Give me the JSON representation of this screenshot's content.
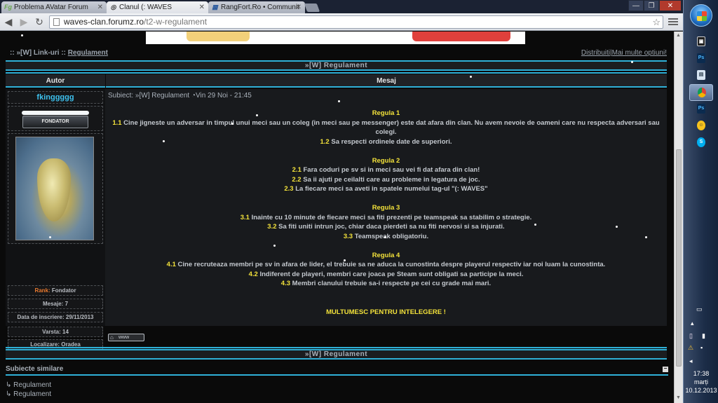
{
  "browser": {
    "tabs": [
      {
        "label": "Problema AVatar Forum",
        "icon": "Fg"
      },
      {
        "label": "Clanul (: WAVES",
        "icon": "◎"
      },
      {
        "label": "RangFort.Ro • Communit",
        "icon": "▦"
      }
    ],
    "url_domain": "waves-clan.forumz.ro",
    "url_path": "/t2-w-regulament"
  },
  "page": {
    "breadcrumb": {
      "prefix": ":: »[W] Link-uri ::",
      "current": "Regulament"
    },
    "options": "Distribuiti|Mai multe optiuni!",
    "topic_title": "»[W] Regulament",
    "col_author": "Autor",
    "col_message": "Mesaj",
    "author": {
      "name": "fkinggggg",
      "rank_title": "FONDATOR",
      "stats": [
        {
          "key": "Rank:",
          "value": " Fondator"
        },
        {
          "key": "Mesaje:",
          "value": " 7"
        },
        {
          "key": "Data de inscriere:",
          "value": " 29/11/2013"
        },
        {
          "key": "Varsta:",
          "value": " 14"
        },
        {
          "key": "Localizare:",
          "value": " Oradea"
        }
      ]
    },
    "post": {
      "subject_label": "Subiect: »[W] Regulament",
      "date": "Vin 29 Noi - 21:45",
      "rules": [
        {
          "heading": "Regula 1",
          "items": [
            {
              "num": "1.1",
              "text": " Cine jigneste un adversar in timpul unui meci sau un coleg (in meci sau pe messenger) este dat afara din clan. Nu avem nevoie de oameni care nu respecta adversari sau colegi."
            },
            {
              "num": "1.2",
              "text": " Sa respecti ordinele date de superiori."
            }
          ]
        },
        {
          "heading": "Regula 2",
          "items": [
            {
              "num": "2.1",
              "text": " Fara coduri pe sv si in meci sau vei fi dat afara din clan!"
            },
            {
              "num": "2.2",
              "text": " Sa ii ajuti pe ceilalti care au probleme in legatura de joc."
            },
            {
              "num": "2.3",
              "text": " La fiecare meci sa aveti in spatele numelui tag-ul \"(: WAVES\""
            }
          ]
        },
        {
          "heading": "Regula 3",
          "items": [
            {
              "num": "3.1",
              "text": " Inainte cu 10 minute de fiecare meci sa fiti prezenti pe teamspeak sa stabilim o strategie."
            },
            {
              "num": "3.2",
              "text": " Sa fiti uniti intrun joc, chiar daca pierdeti sa nu fiti nervosi si sa injurati."
            },
            {
              "num": "3.3",
              "text": " Teamspeak obligatoriu."
            }
          ]
        },
        {
          "heading": "Regula 4",
          "items": [
            {
              "num": "4.1",
              "text": " Cine recruteaza membri pe sv in afara de lider, el trebuie sa ne aduca la cunostinta despre playerul respectiv iar noi luam la cunostinta."
            },
            {
              "num": "4.2",
              "text": " Indiferent de playeri, membri care joaca pe Steam sunt obligati sa participe la meci."
            },
            {
              "num": "4.3",
              "text": " Membri clanului trebuie sa-i respecte pe cei cu grade mai mari."
            }
          ]
        }
      ],
      "closing": "MULTUMESC PENTRU INTELEGERE !",
      "www_button": "www"
    },
    "similar_title": "Subiecte similare",
    "similar_items": [
      "Regulament",
      "Regulament"
    ]
  },
  "taskbar": {
    "time": "17:38",
    "day": "marți",
    "date": "10.12.2013"
  },
  "colors": {
    "accent": "#2fb0d7",
    "rule_heading": "#f3e23a",
    "username": "#3ec2ef"
  }
}
